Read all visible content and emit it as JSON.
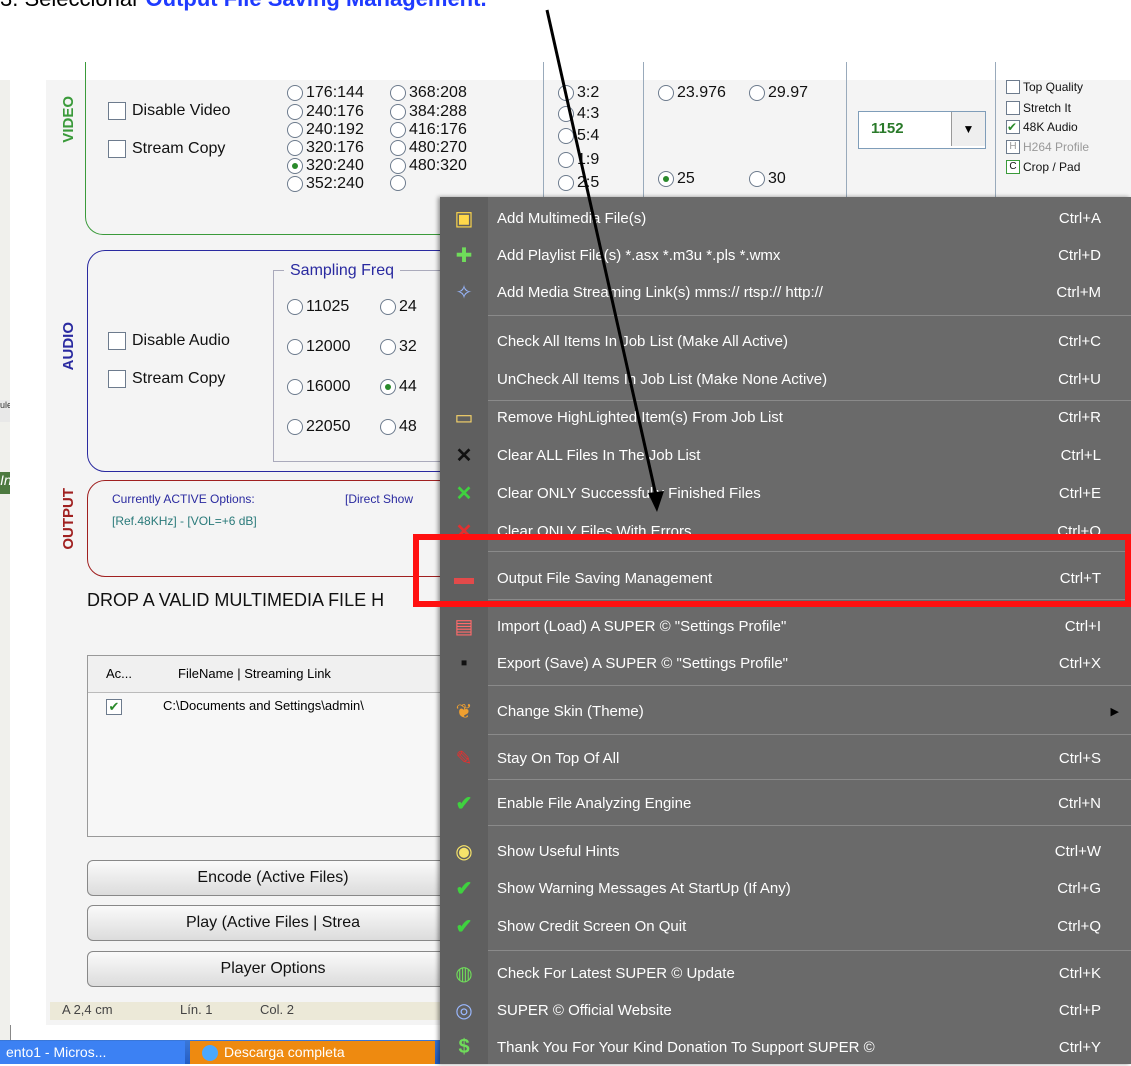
{
  "instruction": {
    "prefix": "3. Seleccionar ",
    "highlight": "Output File Saving Management."
  },
  "video": {
    "section_label": "VIDEO",
    "disable_label": "Disable Video",
    "stream_copy_label": "Stream Copy",
    "sizes_col1": [
      "176:144",
      "240:176",
      "240:192",
      "320:176",
      "320:240",
      "352:240"
    ],
    "sizes_col2": [
      "368:208",
      "384:288",
      "416:176",
      "480:270",
      "480:320"
    ],
    "aspect": [
      "3:2",
      "4:3",
      "5:4",
      "1:9",
      "2:5"
    ],
    "fps": [
      "23.976",
      "29.97",
      "25",
      "30"
    ],
    "bitrate": "1152",
    "options": [
      "Top Quality",
      "Stretch It",
      "48K Audio",
      "H264 Profile",
      "Crop / Pad"
    ],
    "option_badges": [
      "H",
      "C"
    ]
  },
  "audio": {
    "section_label": "AUDIO",
    "disable_label": "Disable Audio",
    "stream_copy_label": "Stream Copy",
    "sampling_title": "Sampling Freq",
    "freq_col1": [
      "11025",
      "12000",
      "16000",
      "22050"
    ],
    "freq_col2": [
      "24",
      "32",
      "44",
      "48"
    ]
  },
  "output": {
    "section_label": "OUTPUT",
    "line1_a": "Currently ACTIVE Options:",
    "line1_b": "[Direct Show",
    "line2": "[Ref.48KHz] - [VOL=+6 dB]"
  },
  "drop_text": "DROP A VALID MULTIMEDIA FILE H",
  "list": {
    "col1": "Ac...",
    "col2": "FileName  |  Streaming Link",
    "row1": "C:\\Documents and Settings\\admin\\"
  },
  "buttons": {
    "encode": "Encode (Active Files)",
    "play": "Play (Active Files | Strea",
    "player_options": "Player Options"
  },
  "status": {
    "pos": "A  2,4 cm",
    "lin": "Lín.  1",
    "col": "Col.  2"
  },
  "side": {
    "a": "uler",
    "b": "Inic"
  },
  "menu": [
    {
      "label": "Add Multimedia File(s)",
      "shortcut": "Ctrl+A"
    },
    {
      "label": "Add Playlist File(s)   *.asx  *.m3u  *.pls  *.wmx",
      "shortcut": "Ctrl+D"
    },
    {
      "label": "Add Media Streaming Link(s)   mms://  rtsp://  http://",
      "shortcut": "Ctrl+M"
    },
    {
      "label": "Check All Items In Job List (Make All Active)",
      "shortcut": "Ctrl+C"
    },
    {
      "label": "UnCheck All Items In Job List (Make None Active)",
      "shortcut": "Ctrl+U"
    },
    {
      "label": "Remove HighLighted Item(s) From Job List",
      "shortcut": "Ctrl+R"
    },
    {
      "label": "Clear ALL Files In The Job List",
      "shortcut": "Ctrl+L"
    },
    {
      "label": "Clear ONLY Successfully Finished Files",
      "shortcut": "Ctrl+E"
    },
    {
      "label": "Clear ONLY Files With Errors",
      "shortcut": "Ctrl+O"
    },
    {
      "label": "Output File Saving Management",
      "shortcut": "Ctrl+T"
    },
    {
      "label": "Import (Load) A SUPER © \"Settings Profile\"",
      "shortcut": "Ctrl+I"
    },
    {
      "label": "Export (Save) A SUPER © \"Settings Profile\"",
      "shortcut": "Ctrl+X"
    },
    {
      "label": "Change Skin (Theme)",
      "shortcut": ""
    },
    {
      "label": "Stay On Top Of All",
      "shortcut": "Ctrl+S"
    },
    {
      "label": "Enable File Analyzing Engine",
      "shortcut": "Ctrl+N"
    },
    {
      "label": "Show Useful Hints",
      "shortcut": "Ctrl+W"
    },
    {
      "label": "Show Warning Messages At StartUp (If Any)",
      "shortcut": "Ctrl+G"
    },
    {
      "label": "Show Credit Screen On Quit",
      "shortcut": "Ctrl+Q"
    },
    {
      "label": "Check For Latest SUPER © Update",
      "shortcut": "Ctrl+K"
    },
    {
      "label": "SUPER © Official Website",
      "shortcut": "Ctrl+P"
    },
    {
      "label": "Thank You For Your Kind Donation To Support SUPER ©",
      "shortcut": "Ctrl+Y"
    }
  ],
  "taskbar": {
    "item1": "ento1 - Micros...",
    "item2": "Descarga completa"
  },
  "colors": {
    "highlight": "#ff1010",
    "menu_bg": "#6a6a6a",
    "video": "#3a9a3a",
    "audio": "#2a2aa0",
    "output": "#a02020"
  }
}
